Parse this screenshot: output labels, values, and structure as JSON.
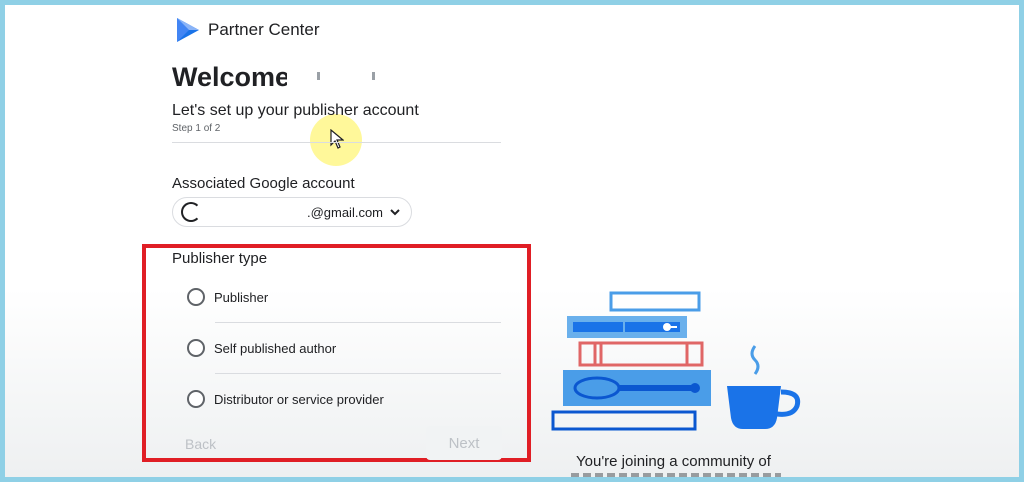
{
  "header": {
    "app_title": "Partner Center",
    "logo_icon": "play-books-logo-icon"
  },
  "welcome": {
    "greeting": "Welcome,",
    "subtitle": "Let's set up your publisher account",
    "step": "Step 1 of 2"
  },
  "account": {
    "label": "Associated Google account",
    "email": ".@gmail.com",
    "avatar_icon": "avatar-icon",
    "dropdown_icon": "chevron-down-icon"
  },
  "publisher_type": {
    "label": "Publisher type",
    "options": [
      {
        "label": "Publisher",
        "selected": false
      },
      {
        "label": "Self published author",
        "selected": false
      },
      {
        "label": "Distributor or service provider",
        "selected": false
      }
    ]
  },
  "buttons": {
    "back_label": "Back",
    "next_label": "Next"
  },
  "illustration": {
    "icon": "books-and-cup-illustration",
    "caption": "You're joining a community of"
  },
  "colors": {
    "accent": "#1a73e8",
    "highlight_border": "#e01e25",
    "frame_border": "#8fd0e6"
  }
}
